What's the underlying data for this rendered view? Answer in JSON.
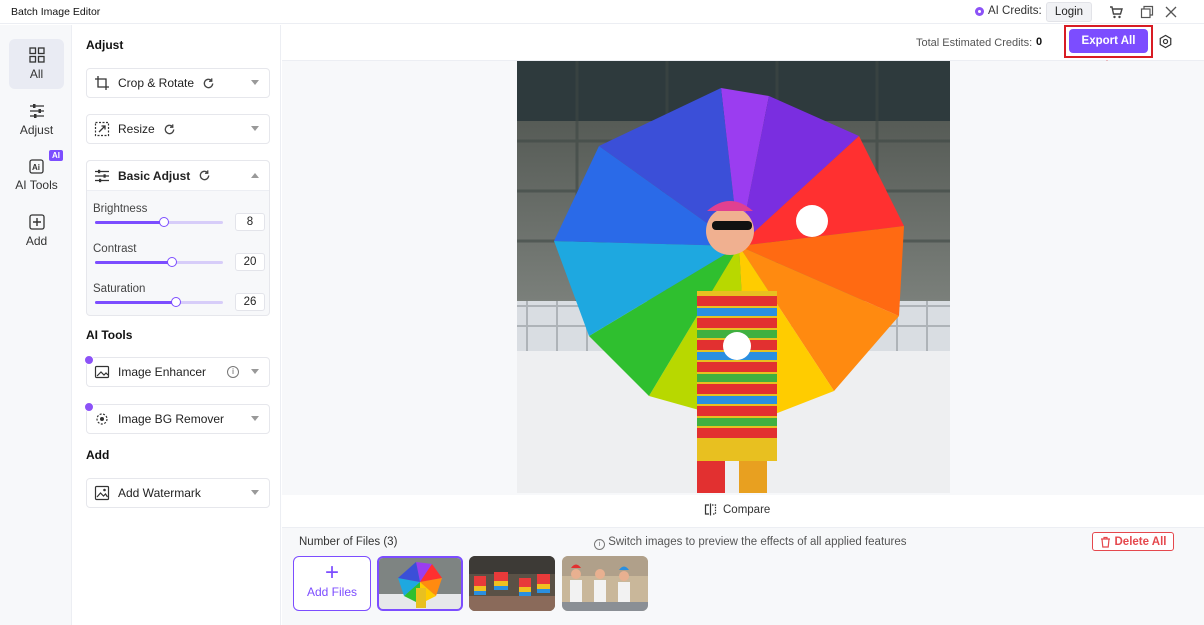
{
  "app": {
    "title": "Batch Image Editor"
  },
  "titlebar": {
    "ai_credits_label": "AI Credits:",
    "login_label": "Login"
  },
  "rail": {
    "items": [
      {
        "label": "All",
        "icon": "grid-icon",
        "active": true
      },
      {
        "label": "Adjust",
        "icon": "sliders-icon"
      },
      {
        "label": "AI Tools",
        "icon": "ai-icon",
        "badge": "AI"
      },
      {
        "label": "Add",
        "icon": "plus-square-icon"
      }
    ]
  },
  "panel": {
    "adjust_title": "Adjust",
    "crop_label": "Crop & Rotate",
    "resize_label": "Resize",
    "basic_adjust_label": "Basic Adjust",
    "sliders": [
      {
        "label": "Brightness",
        "value": "8",
        "level": 0.54
      },
      {
        "label": "Contrast",
        "value": "20",
        "level": 0.6
      },
      {
        "label": "Saturation",
        "value": "26",
        "level": 0.63
      }
    ],
    "ai_tools_title": "AI Tools",
    "enhancer_label": "Image Enhancer",
    "bg_remover_label": "Image BG Remover",
    "add_title": "Add",
    "watermark_label": "Add Watermark"
  },
  "toolbar": {
    "credits_label": "Total Estimated Credits:",
    "credits_value": "0",
    "export_label": "Export All"
  },
  "preview": {
    "compare_label": "Compare"
  },
  "files": {
    "count_label": "Number of Files (3)",
    "hint": "Switch images to preview the effects of all applied features",
    "delete_label": "Delete All",
    "add_label": "Add Files"
  },
  "colors": {
    "accent": "#7c4dff",
    "danger": "#e5484d",
    "highlight": "#d81c24"
  }
}
